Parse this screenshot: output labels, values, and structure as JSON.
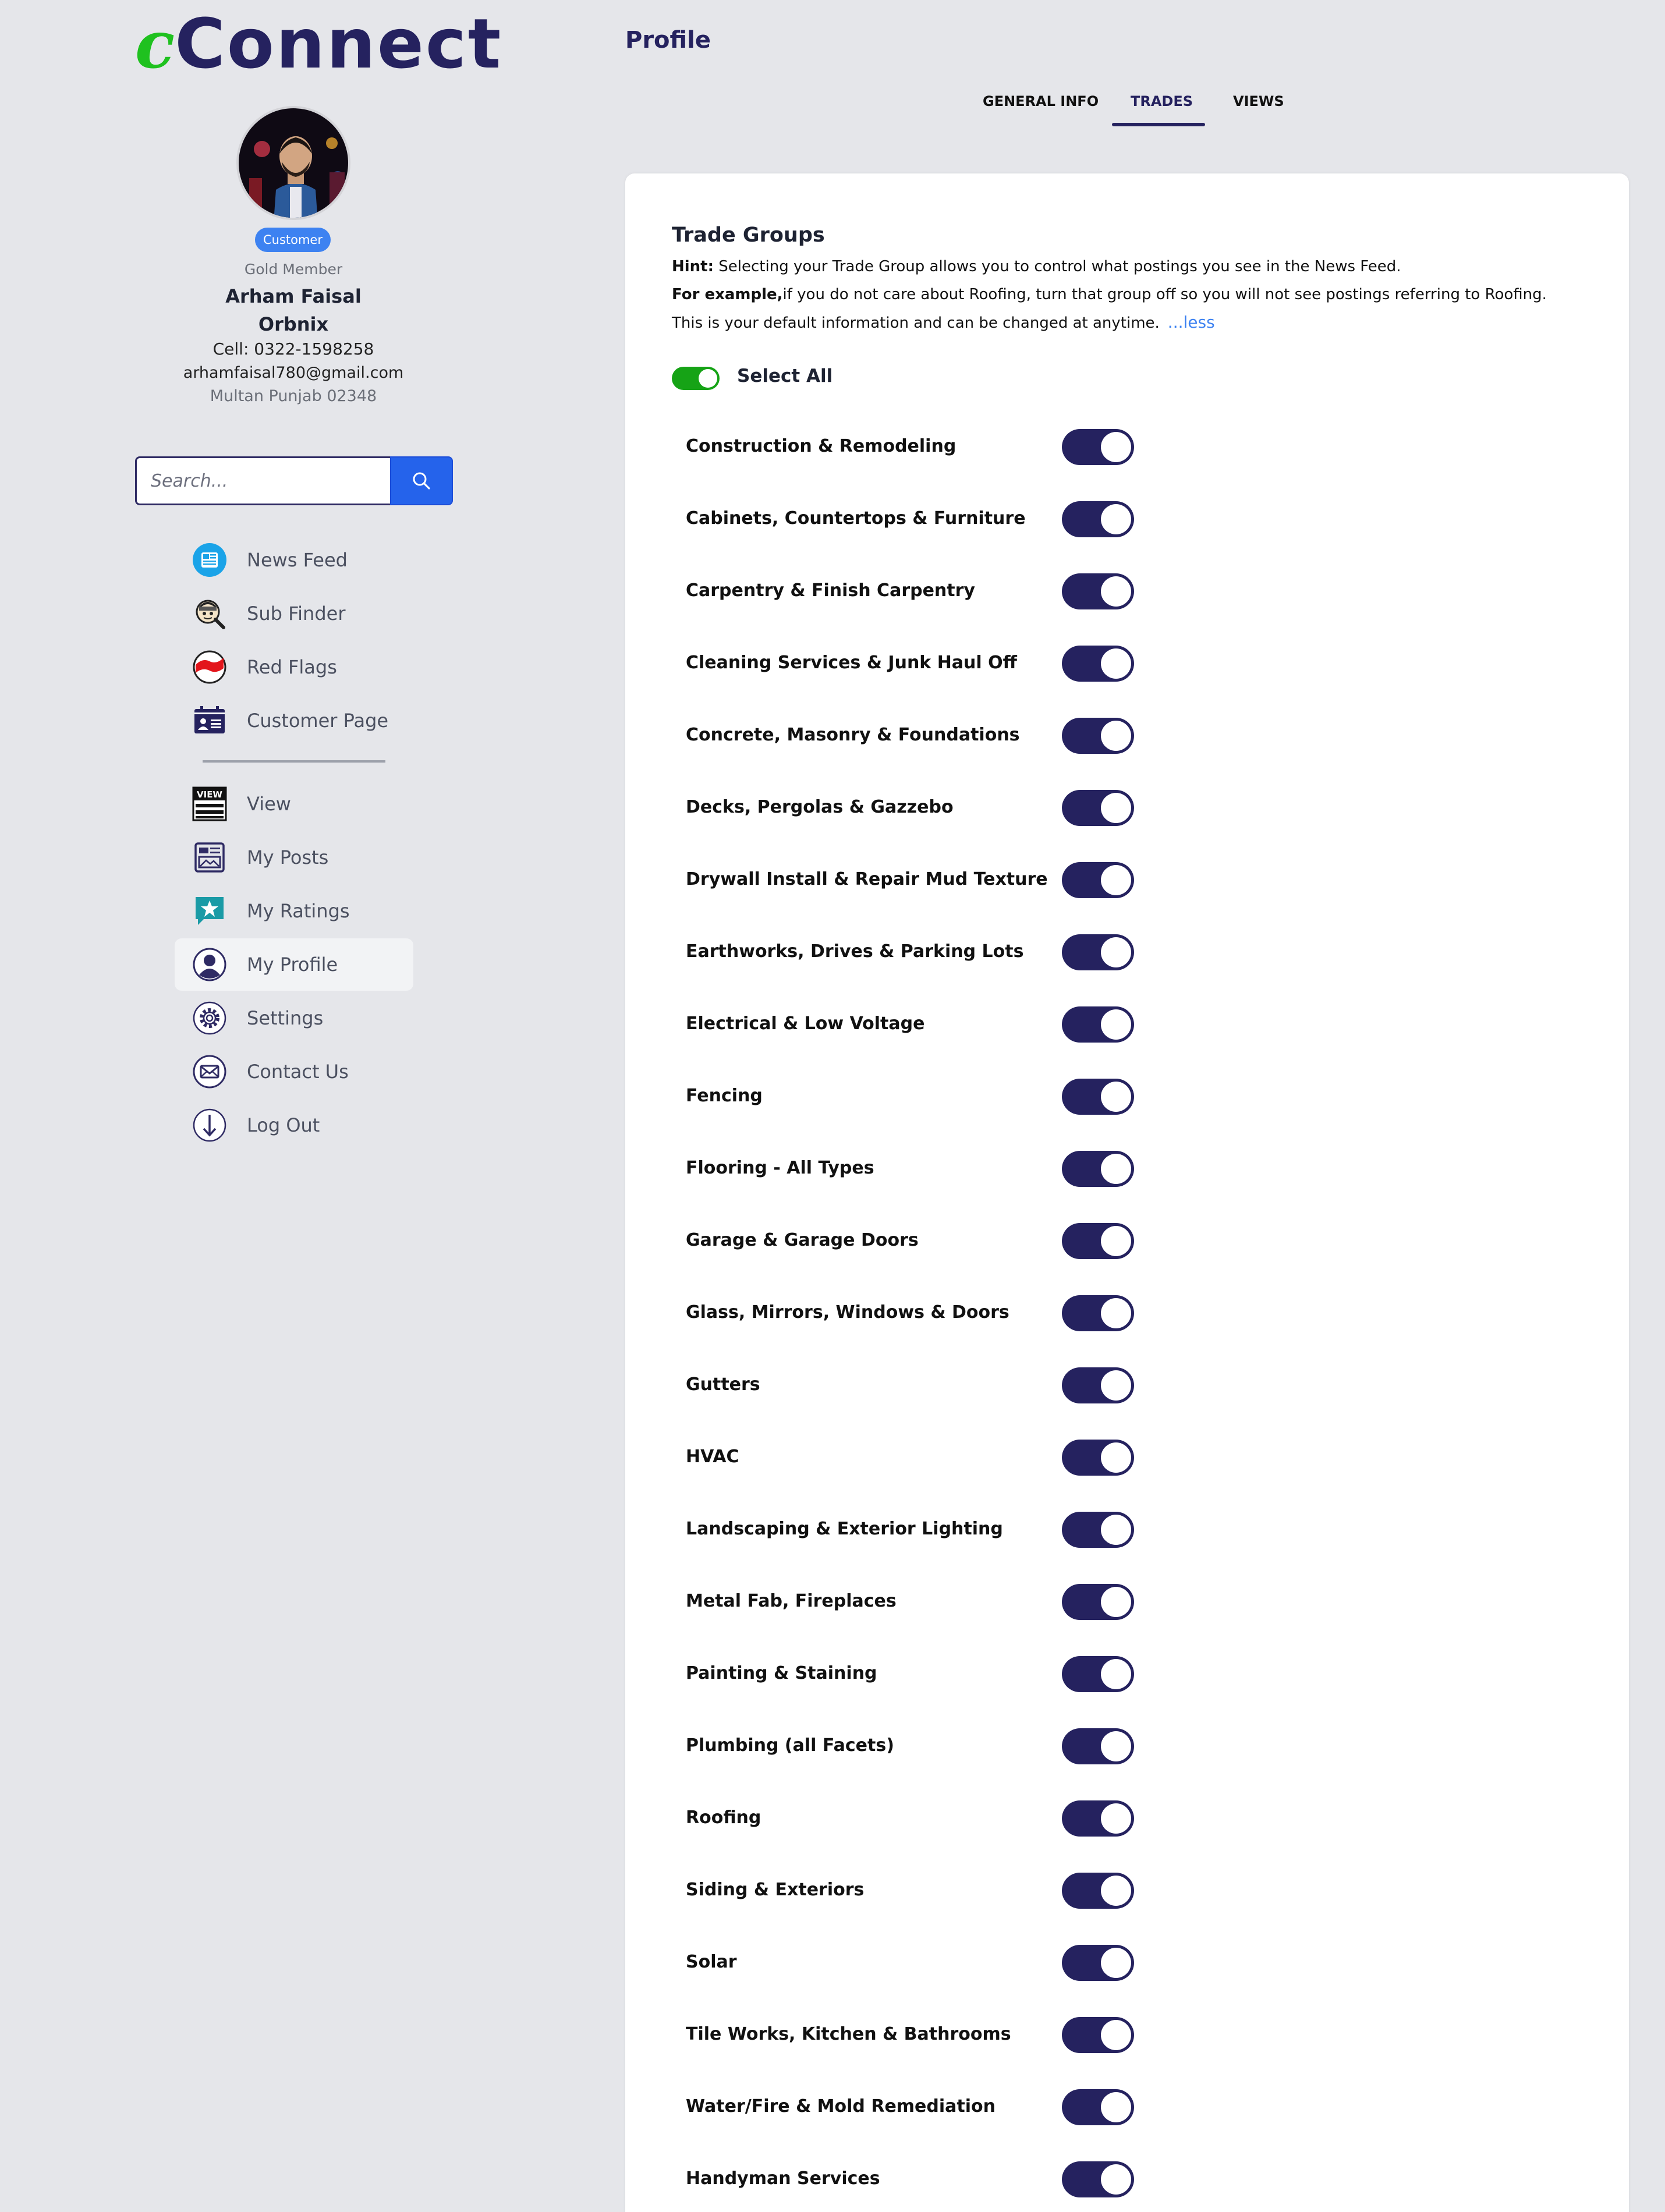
{
  "brand": {
    "c": "c",
    "rest": "Connect"
  },
  "profile": {
    "badge": "Customer",
    "membership": "Gold Member",
    "name": "Arham Faisal",
    "company": "Orbnix",
    "cell": "Cell: 0322-1598258",
    "email": "arhamfaisal780@gmail.com",
    "address": "Multan Punjab 02348"
  },
  "search": {
    "placeholder": "Search..."
  },
  "nav": {
    "primary": [
      {
        "label": "News Feed",
        "icon": "news-feed-icon"
      },
      {
        "label": "Sub Finder",
        "icon": "sub-finder-icon"
      },
      {
        "label": "Red Flags",
        "icon": "red-flag-icon"
      },
      {
        "label": "Customer Page",
        "icon": "customer-page-icon"
      }
    ],
    "secondary": [
      {
        "label": "View",
        "icon": "view-icon"
      },
      {
        "label": "My Posts",
        "icon": "my-posts-icon"
      },
      {
        "label": "My Ratings",
        "icon": "my-ratings-icon"
      },
      {
        "label": "My Profile",
        "icon": "my-profile-icon",
        "active": true
      },
      {
        "label": "Settings",
        "icon": "settings-icon"
      },
      {
        "label": "Contact Us",
        "icon": "contact-icon"
      },
      {
        "label": "Log Out",
        "icon": "logout-icon"
      }
    ]
  },
  "page": {
    "title": "Profile"
  },
  "tabs": [
    {
      "label": "GENERAL INFO"
    },
    {
      "label": "TRADES",
      "active": true
    },
    {
      "label": "VIEWS"
    }
  ],
  "trade_groups": {
    "title": "Trade Groups",
    "hint_label": "Hint:",
    "hint_text": " Selecting your Trade Group allows you to control what postings you see in the News Feed.",
    "example_label": "For example,",
    "example_text": "if you do not care about Roofing, turn that group off so you will not see postings referring to Roofing.",
    "default_text": "This is your default information and can be changed at anytime.",
    "less_link": "...less",
    "select_all": {
      "label": "Select All",
      "on": true
    },
    "groups": [
      {
        "label": "Construction & Remodeling",
        "on": true
      },
      {
        "label": "Cabinets, Countertops & Furniture",
        "on": true
      },
      {
        "label": "Carpentry & Finish Carpentry",
        "on": true
      },
      {
        "label": "Cleaning Services & Junk Haul Off",
        "on": true
      },
      {
        "label": "Concrete, Masonry & Foundations",
        "on": true
      },
      {
        "label": "Decks, Pergolas & Gazzebo",
        "on": true
      },
      {
        "label": "Drywall Install & Repair Mud Texture",
        "on": true
      },
      {
        "label": "Earthworks, Drives & Parking Lots",
        "on": true
      },
      {
        "label": "Electrical & Low Voltage",
        "on": true
      },
      {
        "label": "Fencing",
        "on": true
      },
      {
        "label": "Flooring - All Types",
        "on": true
      },
      {
        "label": "Garage & Garage Doors",
        "on": true
      },
      {
        "label": "Glass, Mirrors, Windows & Doors",
        "on": true
      },
      {
        "label": "Gutters",
        "on": true
      },
      {
        "label": "HVAC",
        "on": true
      },
      {
        "label": "Landscaping & Exterior Lighting",
        "on": true
      },
      {
        "label": "Metal Fab, Fireplaces",
        "on": true
      },
      {
        "label": "Painting & Staining",
        "on": true
      },
      {
        "label": "Plumbing (all Facets)",
        "on": true
      },
      {
        "label": "Roofing",
        "on": true
      },
      {
        "label": "Siding & Exteriors",
        "on": true
      },
      {
        "label": "Solar",
        "on": true
      },
      {
        "label": "Tile Works, Kitchen & Bathrooms",
        "on": true
      },
      {
        "label": "Water/Fire & Mold Remediation",
        "on": true
      },
      {
        "label": "Handyman Services",
        "on": true
      }
    ]
  },
  "colors": {
    "brand_navy": "#25225f",
    "brand_green": "#1fc11f",
    "accent_blue": "#3d82f1",
    "toggle_on": "#25225f",
    "select_all_on": "#16a316"
  }
}
